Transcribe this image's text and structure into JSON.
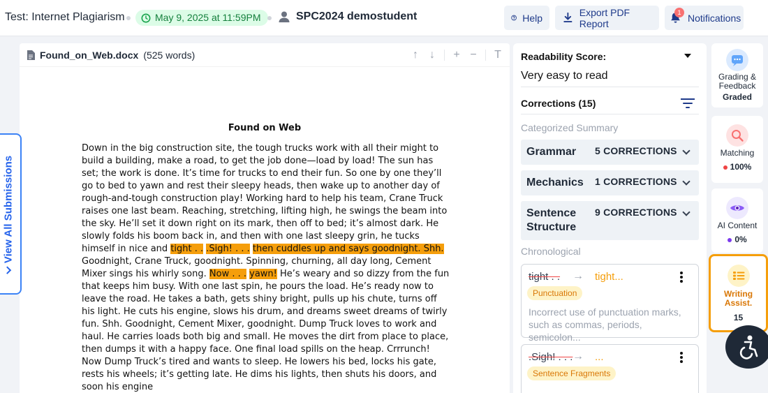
{
  "header": {
    "test_title": "Test: Internet Plagiarism",
    "due_date": "May 9, 2025 at 11:59PM",
    "student": "SPC2024 demostudent",
    "help_label": "Help",
    "export_label": "Export PDF Report",
    "notifications_label": "Notifications",
    "notifications_count": "1"
  },
  "document": {
    "filename": "Found_on_Web.docx",
    "word_count": "(525 words)",
    "title": "Found on Web",
    "segments": [
      {
        "text": "Down in the big construction site, the tough trucks work with all their might to build a building, make a road, to get the job done—load by load! The sun has set; the work is done. It’s time for trucks to end their fun. So one by one they’ll go to bed to yawn and rest their sleepy heads, then wake up to another day of rough-and-tough construction play! Working hard to help his team, Crane Truck raises one last beam. Reaching, stretching, lifting high, he swings the beam into the sky. He’ll set it down right on its mark, then off to bed; it’s almost dark. He slowly folds his boom back in, and then with one last sleepy grin, he tucks himself in nice and ",
        "hl": false
      },
      {
        "text": "tight . .",
        "hl": true
      },
      {
        "text": " ",
        "hl": false
      },
      {
        "text": ".Sigh! . . .",
        "hl": true
      },
      {
        "text": " ",
        "hl": false
      },
      {
        "text": "then cuddles up and says goodnight. Shh.",
        "hl": true
      },
      {
        "text": " Goodnight, Crane Truck, goodnight. Spinning, churning, all day long, Cement Mixer sings his whirly song. ",
        "hl": false
      },
      {
        "text": "Now . . .",
        "hl": true
      },
      {
        "text": " ",
        "hl": false
      },
      {
        "text": "yawn!",
        "hl": true
      },
      {
        "text": " He’s weary and so dizzy from the fun that keeps him busy. With one last spin, he pours the load. He’s ready now to leave the road. He takes a bath, gets shiny bright, pulls up his chute, turns off his light. He cuts his engine, slows his drum, and dreams sweet dreams of twirly fun. Shh. Goodnight, Cement Mixer, goodnight. Dump Truck loves to work and haul. He carries loads both big and small. He moves the dirt from place to place, then dumps it with a happy face. One final load spills on the heap. Crrrunch! Now Dump Truck’s tired and wants to sleep. He lowers his bed, locks his gate, rests his wheels; it’s getting late. He dims his lights, then shuts his doors, and soon his engine",
        "hl": false
      }
    ]
  },
  "side_tab": {
    "label": "View All Submissions"
  },
  "readability": {
    "title": "Readability Score:",
    "value": "Very easy to read"
  },
  "corrections": {
    "title": "Corrections (15)",
    "categorized_heading": "Categorized Summary",
    "categories": [
      {
        "name": "Grammar",
        "count": "5 CORRECTIONS"
      },
      {
        "name": "Mechanics",
        "count": "1 CORRECTIONS"
      },
      {
        "name": "Sentence Structure",
        "count": "9 CORRECTIONS"
      }
    ],
    "chronological_heading": "Chronological",
    "items": [
      {
        "original": "tight . .",
        "suggestion": "tight...",
        "tag": "Punctuation",
        "description": "Incorrect use of punctuation marks, such as commas, periods, semicolon..."
      },
      {
        "original": ".Sigh! . . .",
        "suggestion": "...",
        "tag": "Sentence Fragments",
        "description": ""
      }
    ]
  },
  "rail": [
    {
      "label": "Grading & Feedback",
      "value": "Graded",
      "color": "#3b82f6"
    },
    {
      "label": "Matching",
      "value": "100%",
      "color": "#ef4444"
    },
    {
      "label": "AI Content",
      "value": "0%",
      "color": "#7c3aed"
    },
    {
      "label": "Writing Assist.",
      "value": "15",
      "color": "#f59e0b"
    }
  ],
  "colors": {
    "accent": "#2563eb",
    "highlight": "#f59e0b",
    "due_green": "#15803d"
  }
}
